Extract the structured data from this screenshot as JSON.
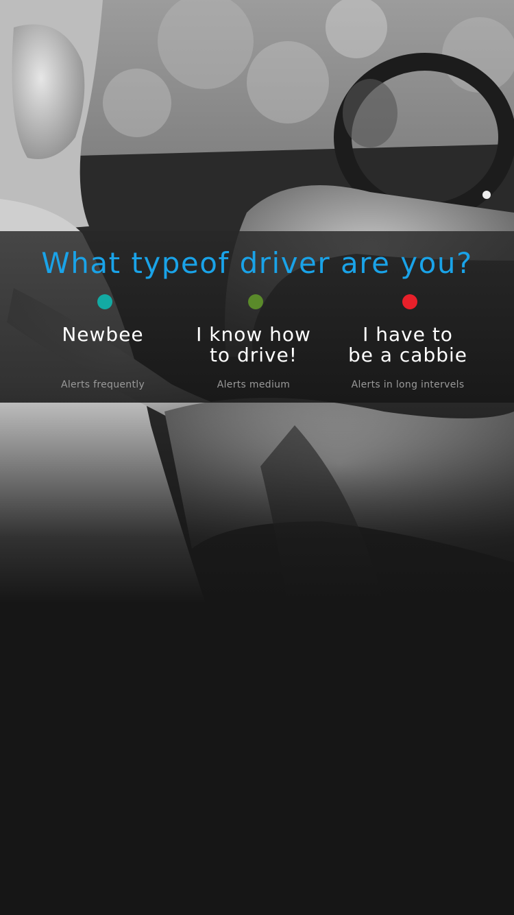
{
  "screen": {
    "background_color": "#161616"
  },
  "background": {
    "image": "monochrome-photo-woman-in-car"
  },
  "question": {
    "title": "What typeof driver are you?",
    "color": "#1aa3e8"
  },
  "options": [
    {
      "label": "Newbee",
      "description": "Alerts frequently",
      "dot_color": "#13aaa3"
    },
    {
      "label": "I know how\nto drive!",
      "description": "Alerts medium",
      "dot_color": "#5a8a2a"
    },
    {
      "label": "I have to\nbe a cabbie",
      "description": "Alerts in long intervels",
      "dot_color": "#e8202a"
    }
  ]
}
